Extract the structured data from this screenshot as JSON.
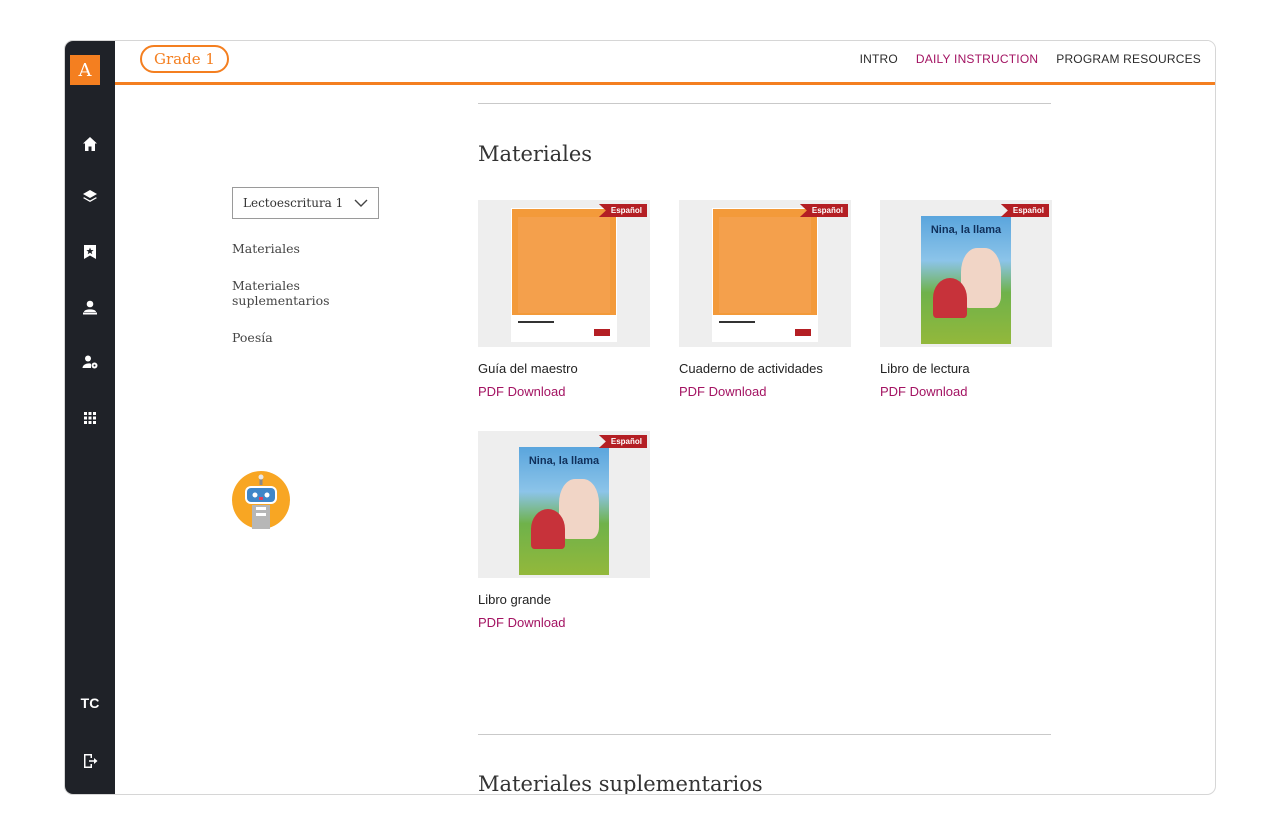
{
  "sidebar": {
    "logo": "A",
    "icons": [
      "home-icon",
      "layers-icon",
      "bookmark-star-icon",
      "teacher-icon",
      "user-settings-icon",
      "grid-icon"
    ],
    "user_initials": "TC",
    "logout_icon": "logout-icon"
  },
  "header": {
    "grade_label": "Grade 1",
    "nav": [
      "INTRO",
      "DAILY INSTRUCTION",
      "PROGRAM RESOURCES"
    ],
    "active_nav": "DAILY INSTRUCTION",
    "accent_color": "#f47f20",
    "link_color": "#a31362"
  },
  "toc": {
    "dropdown_value": "Lectoescritura 1",
    "items": [
      "Materiales",
      "Materiales\nsuplementarios",
      "Poesía"
    ]
  },
  "sections": [
    {
      "title": "Materiales",
      "cards": [
        {
          "title": "Guía del maestro",
          "link": "PDF Download",
          "badge": "Español"
        },
        {
          "title": "Cuaderno de actividades",
          "link": "PDF Download",
          "badge": "Español"
        },
        {
          "title": "Libro de lectura",
          "link": "PDF Download",
          "badge": "Español",
          "cover_title": "Nina, la llama"
        },
        {
          "title": "Libro grande",
          "link": "PDF Download",
          "badge": "Español",
          "cover_title": "Nina, la llama"
        }
      ]
    },
    {
      "title": "Materiales suplementarios"
    }
  ]
}
